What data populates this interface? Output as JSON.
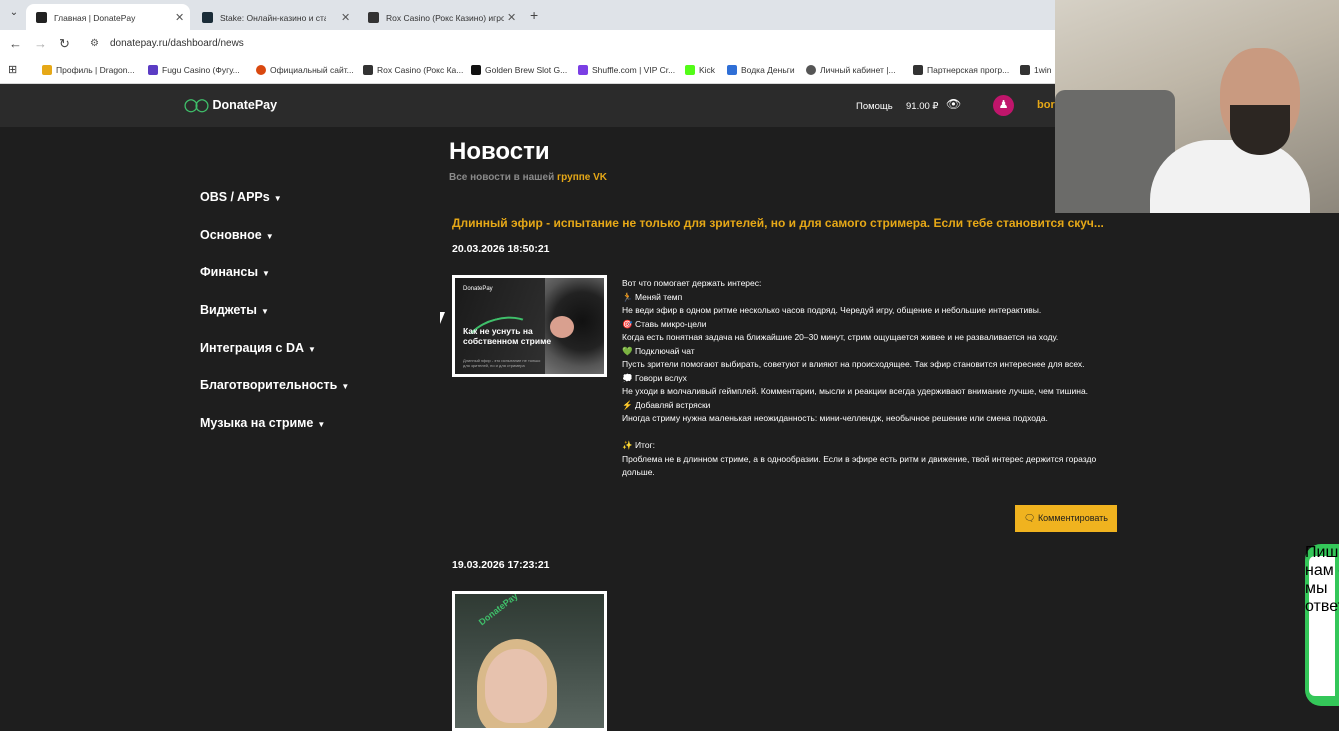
{
  "browser": {
    "tabs": [
      {
        "label": "Главная | DonatePay",
        "active": true,
        "favicon_color": "#222222"
      },
      {
        "label": "Stake: Онлайн-казино и ставки",
        "active": false,
        "favicon_color": "#1a2c38"
      },
      {
        "label": "Rox Casino (Рокс Казино) игро",
        "active": false,
        "favicon_color": "#333333"
      }
    ],
    "url": "donatepay.ru/dashboard/news",
    "bookmarks": [
      {
        "label": "Профиль | Dragon...",
        "color": "#e6a817"
      },
      {
        "label": "Fugu Casino (Фугу...",
        "color": "#5b3cc4"
      },
      {
        "label": "Официальный сайт...",
        "color": "#d9480f"
      },
      {
        "label": "Rox Casino (Рокс Ка...",
        "color": "#333333"
      },
      {
        "label": "Golden Brew Slot G...",
        "color": "#111111"
      },
      {
        "label": "Shuffle.com | VIP Cr...",
        "color": "#7b3fe4"
      },
      {
        "label": "Kick",
        "color": "#53fc18"
      },
      {
        "label": "Водка Деньги",
        "color": "#2f6fd6"
      },
      {
        "label": "Личный кабинет |...",
        "color": "#555555"
      },
      {
        "label": "Партнерская прогр...",
        "color": "#333333"
      },
      {
        "label": "1win",
        "color": "#333333"
      }
    ]
  },
  "header": {
    "logo": "DonatePay",
    "help": "Помощь",
    "balance": "91.00 ₽",
    "username": "bor"
  },
  "sidebar": {
    "items": [
      {
        "label": "OBS / APPs"
      },
      {
        "label": "Основное"
      },
      {
        "label": "Финансы"
      },
      {
        "label": "Виджеты"
      },
      {
        "label": "Интеграция с DA"
      },
      {
        "label": "Благотворительность"
      },
      {
        "label": "Музыка на стриме"
      }
    ]
  },
  "main": {
    "title": "Новости",
    "subtitle_prefix": "Все новости в нашей",
    "subtitle_link": "группе VK",
    "posts": [
      {
        "title": "Длинный эфир - испытание не только для зрителей, но и для самого стримера. Если тебе становится скуч...",
        "date": "20.03.2026 18:50:21",
        "thumb_logo": "DonatePay",
        "thumb_text": "Как не уснуть на собственном стриме",
        "thumb_small": "Длинный эфир - это испытание не только для зрителей, но и для стримера",
        "body": [
          "Вот что помогает держать интерес:",
          "🏃 Меняй темп",
          "Не веди эфир в одном ритме несколько часов подряд. Чередуй игру, общение и небольшие интерактивы.",
          "🎯 Ставь микро-цели",
          "Когда есть понятная задача на ближайшие 20–30 минут, стрим ощущается живее и не разваливается на ходу.",
          "💚 Подключай чат",
          "Пусть зрители помогают выбирать, советуют и влияют на происходящее. Так эфир становится интереснее для всех.",
          "💭 Говори вслух",
          "Не уходи в молчаливый геймплей. Комментарии, мысли и реакции всегда удерживают внимание лучше, чем тишина.",
          "⚡ Добавляй встряски",
          "Иногда стриму нужна маленькая неожиданность: мини-челлендж, необычное решение или смена подхода.",
          "",
          "✨ Итог:",
          "Проблема не в длинном стриме, а в однообразии. Если в эфире есть ритм и движение, твой интерес держится гораздо дольше."
        ],
        "comment_button": "Комментировать"
      },
      {
        "date": "19.03.2026 17:23:21",
        "thumb_logo": "DonatePay"
      }
    ]
  },
  "feedback_tab": "Пишите нам - мы ответим!",
  "colors": {
    "accent": "#e6a817",
    "button": "#f0b31f",
    "page_bg": "#1e1e1e",
    "header_bg": "#2b2b2b",
    "green": "#3fbf6a"
  }
}
